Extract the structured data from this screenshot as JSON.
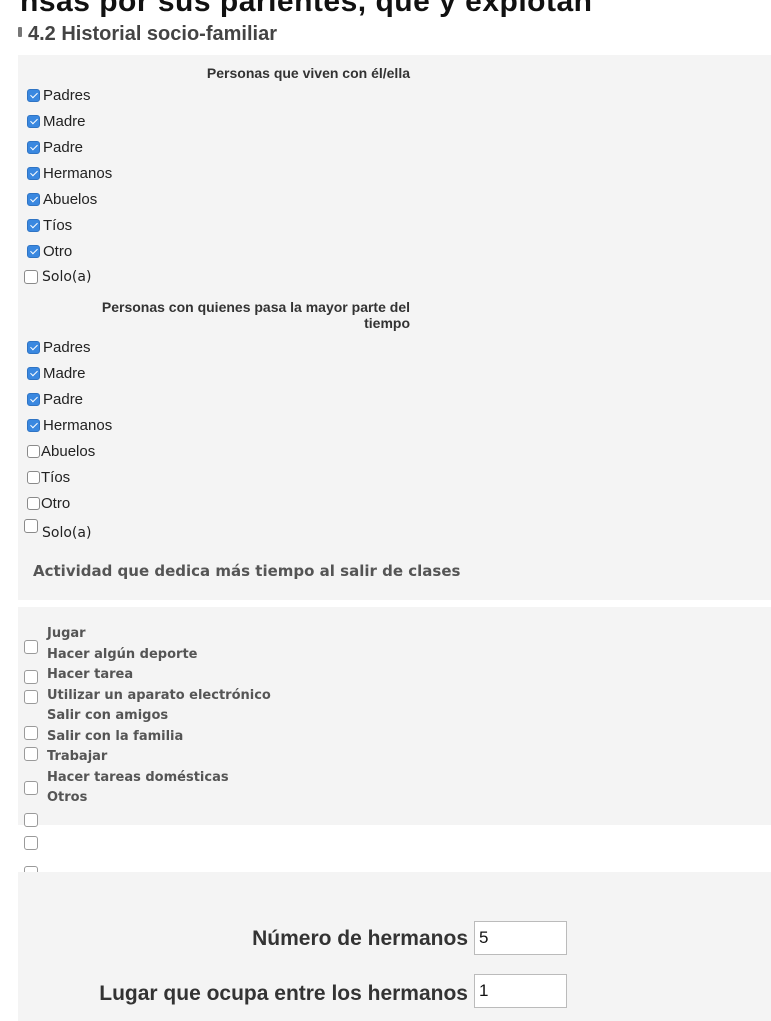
{
  "top_clipped_text": "nsas por sus parientes, que y explotan",
  "section_title": "4.2 Historial socio-familiar",
  "group1": {
    "heading": "Personas que viven con él/ella",
    "options": [
      {
        "label": "Padres",
        "checked": true
      },
      {
        "label": "Madre",
        "checked": true
      },
      {
        "label": "Padre",
        "checked": true
      },
      {
        "label": "Hermanos",
        "checked": true
      },
      {
        "label": "Abuelos",
        "checked": true
      },
      {
        "label": "Tíos",
        "checked": true
      },
      {
        "label": "Otro",
        "checked": true
      },
      {
        "label": "Solo(a)",
        "checked": false
      }
    ]
  },
  "group2": {
    "heading_line1": "Personas con quienes pasa la mayor parte del",
    "heading_line2": "tiempo",
    "options": [
      {
        "label": "Padres",
        "checked": true
      },
      {
        "label": "Madre",
        "checked": true
      },
      {
        "label": "Padre",
        "checked": true
      },
      {
        "label": "Hermanos",
        "checked": true
      },
      {
        "label": "Abuelos",
        "checked": false
      },
      {
        "label": "Tíos",
        "checked": false
      },
      {
        "label": "Otro",
        "checked": false
      },
      {
        "label": "Solo(a)",
        "checked": false
      }
    ]
  },
  "activity": {
    "title": "Actividad que dedica más tiempo al salir de clases",
    "options": [
      "Jugar",
      "Hacer algún deporte",
      "Hacer tarea",
      "Utilizar un aparato electrónico",
      "Salir con amigos",
      "Salir con la familia",
      "Trabajar",
      "Hacer tareas domésticas",
      "Otros"
    ]
  },
  "siblings": {
    "count_label": "Número de hermanos",
    "count_value": "5",
    "position_label": "Lugar que ocupa entre los hermanos",
    "position_value": "1"
  }
}
